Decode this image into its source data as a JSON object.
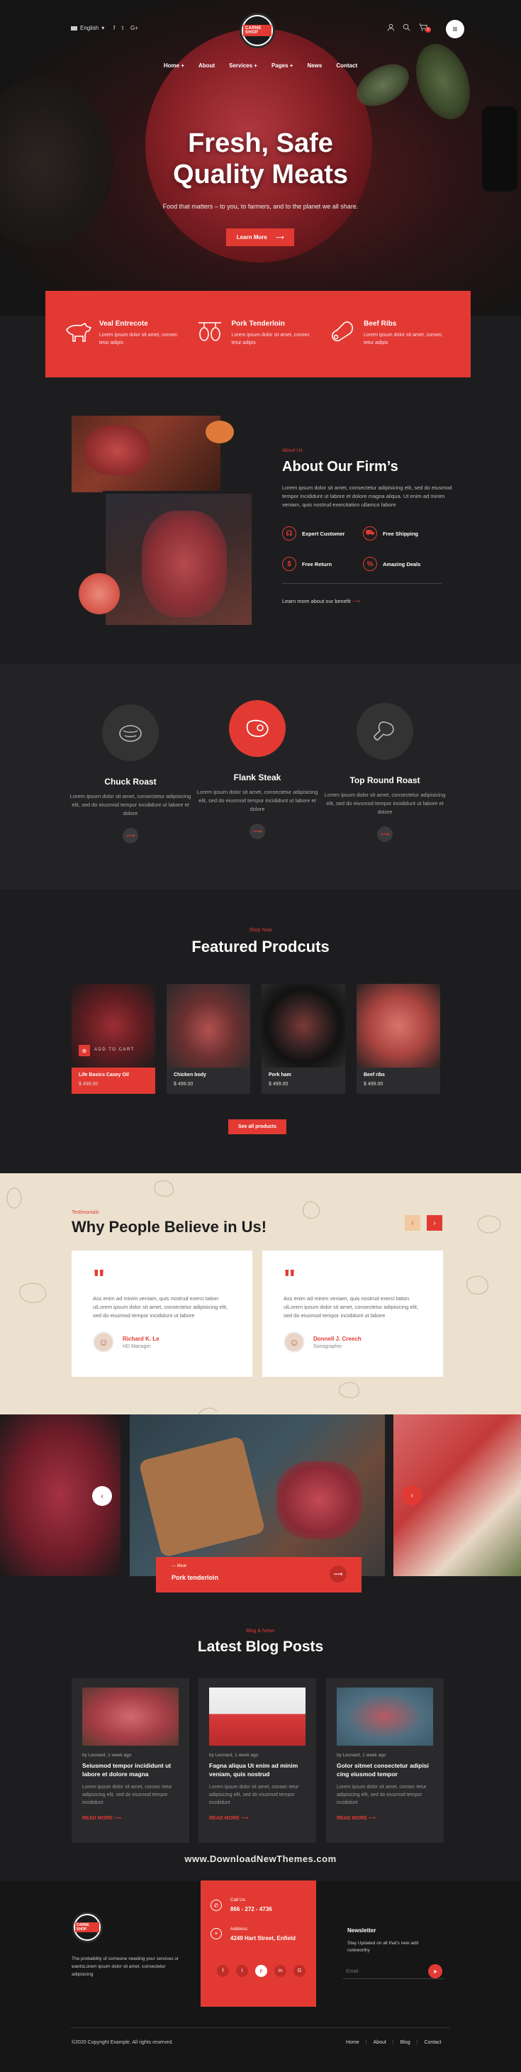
{
  "header": {
    "language": "English",
    "social": [
      "f",
      "t",
      "G+"
    ],
    "logo_text": "CARNE SHOP",
    "cart_count": "0",
    "nav": [
      "Home",
      "About",
      "Services",
      "Pages",
      "News",
      "Contact"
    ]
  },
  "hero": {
    "title_line1": "Fresh, Safe",
    "title_line2": "Quality Meats",
    "subtitle": "Food that matters – to you, to farmers, and to the planet we all share.",
    "button": "Learn More"
  },
  "features": [
    {
      "title": "Veal Entrecote",
      "desc": "Lorem ipsum dolor sit amet, consec tetur adipis",
      "icon": "cow-icon"
    },
    {
      "title": "Pork Tenderloin",
      "desc": "Lorem ipsum dolor sit amet, consec tetur adipis",
      "icon": "sausage-icon"
    },
    {
      "title": "Beef Ribs",
      "desc": "Lorem ipsum dolor sit amet, consec tetur adipis",
      "icon": "ham-icon"
    }
  ],
  "about": {
    "kicker": "About Us",
    "title": "About Our Firm’s",
    "text": "Lorem ipsum dolor sit amet, consectetur adipisicing elit, sed do eiusmod tempor incididunt ut labore et dolore magna aliqua. Ut enim ad minim veniam, quis nostrud exercitation ullamco labore",
    "features": [
      "Expert Customer",
      "Free Shipping",
      "Free Return",
      "Amazing Deals"
    ],
    "link": "Learn more about our benefit"
  },
  "cuts": [
    {
      "title": "Chuck Roast",
      "desc": "Lorem ipsum dolor sit amet, consectetur adipisicing elit, sed do eiusmod tempor incididunt ut labore et dolore"
    },
    {
      "title": "Flank Steak",
      "desc": "Lorem ipsum dolor sit amet, consectetur adipisicing elit, sed do eiusmod tempor incididunt ut labore et dolore"
    },
    {
      "title": "Top Round Roast",
      "desc": "Lorem ipsum dolor sit amet, consectetur adipisicing elit, sed do eiusmod tempor incididunt ut labore et dolore"
    }
  ],
  "products": {
    "kicker": "Shop Now",
    "title": "Featured Prodcuts",
    "add_to_cart": "ADD TO CART",
    "items": [
      {
        "name": "Life Basics Casey Oil",
        "price": "$ 499.00"
      },
      {
        "name": "Chicken body",
        "price": "$ 499.00"
      },
      {
        "name": "Pork ham",
        "price": "$ 499.00"
      },
      {
        "name": "Beef ribs",
        "price": "$ 499.00"
      }
    ],
    "see_all": "See all products"
  },
  "testimonials": {
    "kicker": "Testimonials",
    "title": "Why People Believe in Us!",
    "items": [
      {
        "text": "Ass enim ad minim veniam, quis nostrud exerci tation ulLorem ipsum dolor sit amet, consectetur adipisicing elit, sed do eiusmod tempor incididunt ut labore",
        "name": "Richard K. Le",
        "role": "HD Manager"
      },
      {
        "text": "Ass enim ad minim veniam, quis nostrud exerci tation ulLorem ipsum dolor sit amet, consectetur adipisicing elit, sed do eiusmod tempor incididunt ut labore",
        "name": "Donnell J. Creech",
        "role": "Sonographer"
      }
    ]
  },
  "gallery": {
    "caption_kicker": "Meat",
    "caption_title": "Pork tenderloin"
  },
  "blog": {
    "kicker": "Blog & News",
    "title": "Latest Blog Posts",
    "posts": [
      {
        "meta": "by Leonard, 1 week ago",
        "title": "Seiusmod tempor incididunt ut labore et dolore magna",
        "desc": "Lorem ipsum dolor sit amet, consec tetur adipisicing elit, sed do eiusmod tempor incididunt",
        "link": "READ MORE"
      },
      {
        "meta": "by Leonard, 1 week ago",
        "title": "Fagna aliqua Ut enim ad minim veniam, quis nostrud",
        "desc": "Lorem ipsum dolor sit amet, consec tetur adipisicing elit, sed do eiusmod tempor incididunt",
        "link": "READ MORE"
      },
      {
        "meta": "by Leonard, 1 week ago",
        "title": "Golor sitmet consectetur adipisi cing eiusmod tempor",
        "desc": "Lorem ipsum dolor sit amet, consec tetur adipisicing elit, sed do eiusmod tempor incididunt",
        "link": "READ MORE"
      }
    ]
  },
  "watermark": "www.DownloadNewThemes.com",
  "footer": {
    "about": "The probability of someone needing your services or wantsLorem ipsum dolor sit amet, consectetur adipisicing",
    "call_label": "Call Us",
    "call_value": "866 - 272 - 4736",
    "address_label": "Address",
    "address_value": "4249 Hart Street, Enfield",
    "social": [
      "f",
      "t",
      "p",
      "in",
      "G"
    ],
    "newsletter_title": "Newsletter",
    "newsletter_text": "Stay Updated on all that's new add noteworthy",
    "email_placeholder": "Email",
    "copyright": "©2020 Copyright Example. All rights reserved.",
    "links": [
      "Home",
      "About",
      "Blog",
      "Contact"
    ]
  }
}
